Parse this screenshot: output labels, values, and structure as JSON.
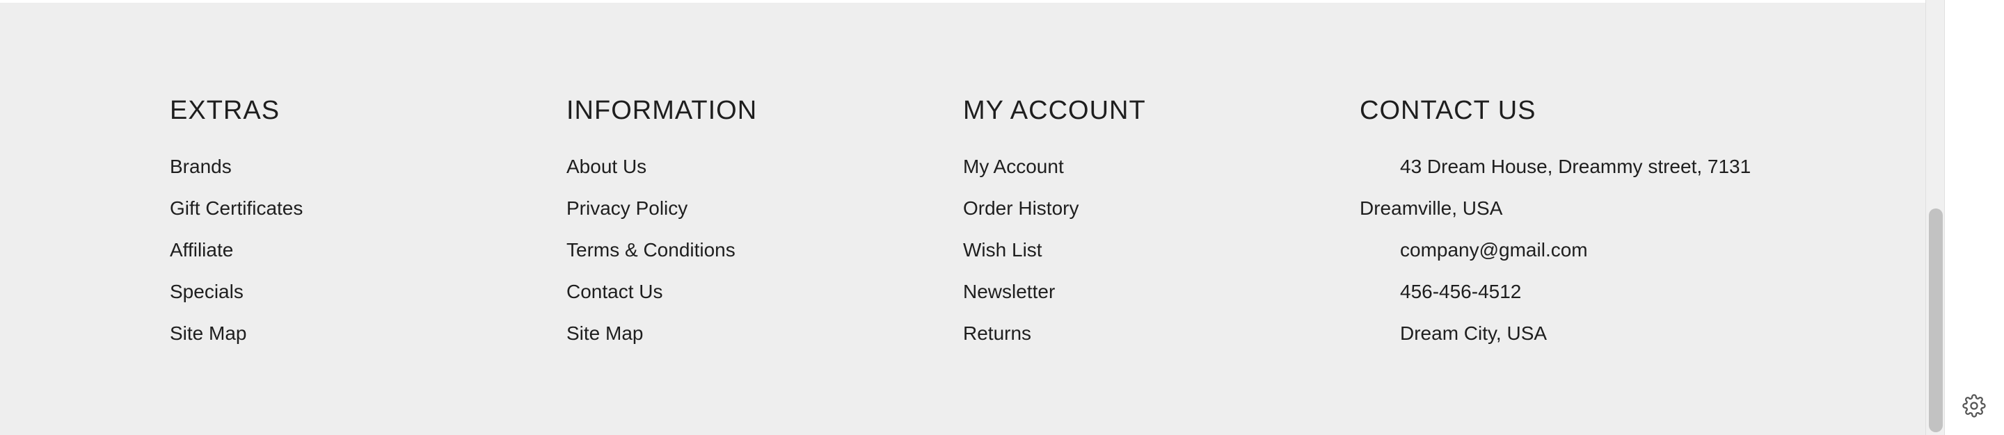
{
  "footer": {
    "columns": [
      {
        "heading": "EXTRAS",
        "links": [
          "Brands",
          "Gift Certificates",
          "Affiliate",
          "Specials",
          "Site Map"
        ]
      },
      {
        "heading": "INFORMATION",
        "links": [
          "About Us",
          "Privacy Policy",
          "Terms & Conditions",
          "Contact Us",
          "Site Map"
        ]
      },
      {
        "heading": "MY ACCOUNT",
        "links": [
          "My Account",
          "Order History",
          "Wish List",
          "Newsletter",
          "Returns"
        ]
      }
    ],
    "contact": {
      "heading": "CONTACT US",
      "address_line1": "43 Dream House, Dreammy street, 7131",
      "address_line2": "Dreamville, USA",
      "email": "company@gmail.com",
      "phone": "456-456-4512",
      "city": "Dream City, USA"
    }
  },
  "icons": {
    "settings": "gear-icon"
  },
  "colors": {
    "footer_bg": "#eeeeee",
    "text": "#1e1e1e",
    "scroll_thumb": "#c2c2c2"
  }
}
